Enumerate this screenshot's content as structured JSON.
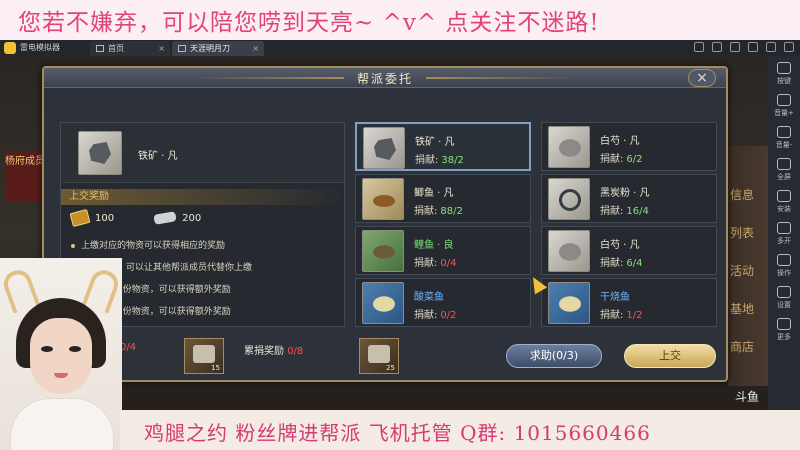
{
  "overlay": {
    "top_banner": "您若不嫌弃，可以陪您唠到天亮~ ^v^  点关注不迷路!",
    "bottom_banner": "鸡腿之约  粉丝牌进帮派  飞机托管 Q群: 1015660466"
  },
  "emulator": {
    "app_name": "雷电模拟器",
    "tabs": [
      {
        "label": "首页",
        "icon": "home-icon"
      },
      {
        "label": "天涯明月刀",
        "icon": "game-icon"
      }
    ],
    "toolbar": [
      {
        "label": "按键",
        "icon": "keyboard-icon"
      },
      {
        "label": "音量+",
        "icon": "volume-up-icon"
      },
      {
        "label": "音量-",
        "icon": "volume-down-icon"
      },
      {
        "label": "全屏",
        "icon": "fullscreen-icon"
      },
      {
        "label": "安装",
        "icon": "install-icon"
      },
      {
        "label": "多开",
        "icon": "multi-instance-icon"
      },
      {
        "label": "操作",
        "icon": "operation-icon"
      },
      {
        "label": "设置",
        "icon": "settings-icon"
      },
      {
        "label": "更多",
        "icon": "more-icon"
      }
    ]
  },
  "background": {
    "left_banner": "杨府成员",
    "right_signs": [
      "信息",
      "列表",
      "活动",
      "基地",
      "商店"
    ],
    "watermark": "斗鱼"
  },
  "dialog": {
    "title": "帮派委托",
    "close_label": "×",
    "selected_item": {
      "name": "铁矿 · 凡",
      "icon": "iron-ore-icon"
    },
    "reward_header": "上交奖励",
    "rewards": [
      {
        "icon": "coin-icon",
        "value": "100"
      },
      {
        "icon": "silver-icon",
        "value": "200"
      }
    ],
    "rules": [
      "上缴对应的物资可以获得相应的奖励",
      "求助帮助，可以让其他帮派成员代替你上缴",
      "累计上缴4份物资，可以获得额外奖励",
      "累计上缴8份物资，可以获得额外奖励"
    ],
    "items": [
      {
        "name": "铁矿 · 凡",
        "contrib_label": "捐献:",
        "contrib": "38/2",
        "icon": "iron-ore-icon",
        "style": "grey",
        "name_color": "normal",
        "contrib_color": "green",
        "active": true
      },
      {
        "name": "白芍 · 凡",
        "contrib_label": "捐献:",
        "contrib": "6/2",
        "icon": "herb-icon",
        "style": "pale",
        "name_color": "normal",
        "contrib_color": "green",
        "active": false
      },
      {
        "name": "鲫鱼 · 凡",
        "contrib_label": "捐献:",
        "contrib": "88/2",
        "icon": "fish-icon",
        "style": "fish",
        "name_color": "normal",
        "contrib_color": "green",
        "active": false
      },
      {
        "name": "黑炭粉 · 凡",
        "contrib_label": "捐献:",
        "contrib": "16/4",
        "icon": "charcoal-icon",
        "style": "ring",
        "name_color": "normal",
        "contrib_color": "green",
        "active": false
      },
      {
        "name": "鲤鱼 · 良",
        "contrib_label": "捐献:",
        "contrib": "0/4",
        "icon": "carp-icon",
        "style": "green",
        "name_color": "green",
        "contrib_color": "red",
        "active": false
      },
      {
        "name": "白芍 · 凡",
        "contrib_label": "捐献:",
        "contrib": "6/4",
        "icon": "herb-icon",
        "style": "pale",
        "name_color": "normal",
        "contrib_color": "green",
        "active": false
      },
      {
        "name": "酸菜鱼",
        "contrib_label": "捐献:",
        "contrib": "0/2",
        "icon": "pickled-fish-icon",
        "style": "blue",
        "name_color": "blue",
        "contrib_color": "red",
        "active": false
      },
      {
        "name": "干烧鱼",
        "contrib_label": "捐献:",
        "contrib": "1/2",
        "icon": "braised-fish-icon",
        "style": "blue",
        "name_color": "blue",
        "contrib_color": "red",
        "active": false
      }
    ],
    "progress_left": "0/4",
    "chest1_qty": "15",
    "cumulative_label": "累捐奖励",
    "cumulative_value": "0/8",
    "chest2_qty": "25",
    "help_button": "求助(0/3)",
    "submit_button": "上交"
  },
  "colors": {
    "accent_gold": "#a48c62",
    "contrib_green": "#8ce07f",
    "contrib_red": "#ff4f4f",
    "banner_pink": "#e0447a"
  }
}
